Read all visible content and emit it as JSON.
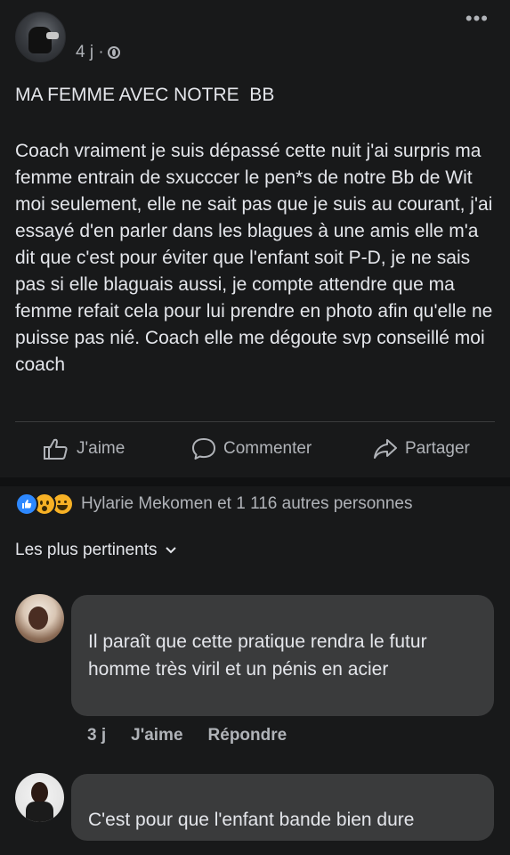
{
  "post": {
    "timestamp": "4 j ·",
    "privacy_icon": "globe-icon",
    "more_icon": "•••",
    "title": "MA FEMME AVEC NOTRE  BB",
    "body": "Coach vraiment je suis dépassé cette nuit j'ai surpris ma femme entrain de sxucccer le pen*s de notre Bb de Wit moi seulement, elle ne sait pas que je suis au courant, j'ai essayé d'en parler dans les blagues à une amis elle m'a dit que c'est pour éviter que l'enfant soit P-D, je ne sais pas si elle blaguais aussi, je compte attendre que ma femme refait cela pour lui prendre en photo afin qu'elle ne puisse pas nié. Coach elle me dégoute svp conseillé moi coach"
  },
  "actions": {
    "like": "J'aime",
    "comment": "Commenter",
    "share": "Partager"
  },
  "reactions": {
    "icons": [
      "like-reaction-icon",
      "wow-reaction-icon",
      "haha-reaction-icon"
    ],
    "summary": "Hylarie Mekomen et 1 116 autres personnes"
  },
  "sort": {
    "label": "Les plus pertinents"
  },
  "comments": [
    {
      "text": "Il paraît que cette pratique rendra le futur homme très viril et un pénis en acier",
      "time": "3 j",
      "like": "J'aime",
      "reply": "Répondre"
    },
    {
      "text": "C'est pour que l'enfant bande bien dure",
      "time": "",
      "like": "",
      "reply": ""
    }
  ],
  "colors": {
    "background": "#18191a",
    "bubble": "#3a3b3c",
    "text": "#e4e6eb",
    "secondary_text": "#b0b3b8",
    "like_blue": "#2d88ff",
    "reaction_yellow": "#f7b125"
  }
}
